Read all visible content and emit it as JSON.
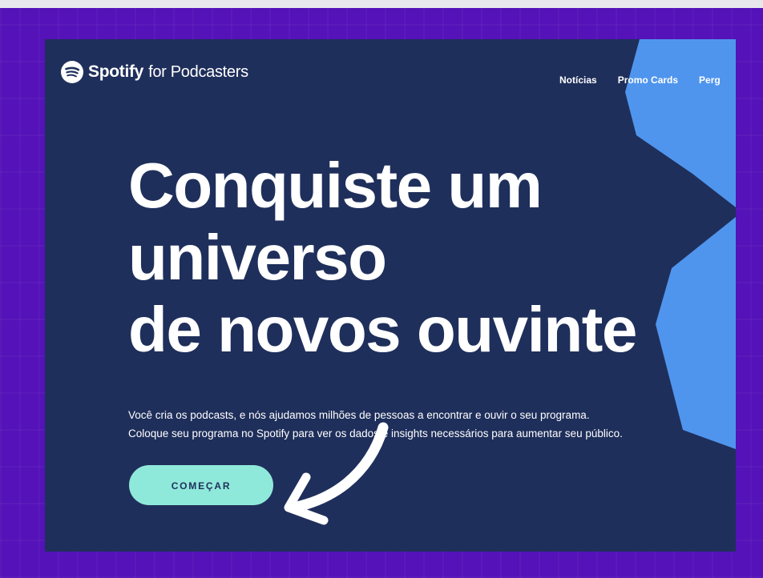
{
  "logo": {
    "brand": "Spotify",
    "suffix": "for Podcasters",
    "icon": "spotify-icon"
  },
  "nav": {
    "items": [
      "Notícias",
      "Promo Cards",
      "Perg"
    ]
  },
  "hero": {
    "headline_lines": [
      "Conquiste um",
      "universo",
      "de novos ouvinte"
    ],
    "description_lines": [
      "Você cria os podcasts, e nós ajudamos milhões de pessoas a encontrar e ouvir o seu programa.",
      "Coloque seu programa no Spotify para ver os dados e insights necessários para aumentar seu público."
    ],
    "cta_label": "COMEÇAR"
  },
  "colors": {
    "frame": "#5412b8",
    "site_background": "#1f2f5b",
    "decor_blue": "#4f95ee",
    "cta_background": "#8fe9da",
    "arrow": "#ffffff"
  }
}
